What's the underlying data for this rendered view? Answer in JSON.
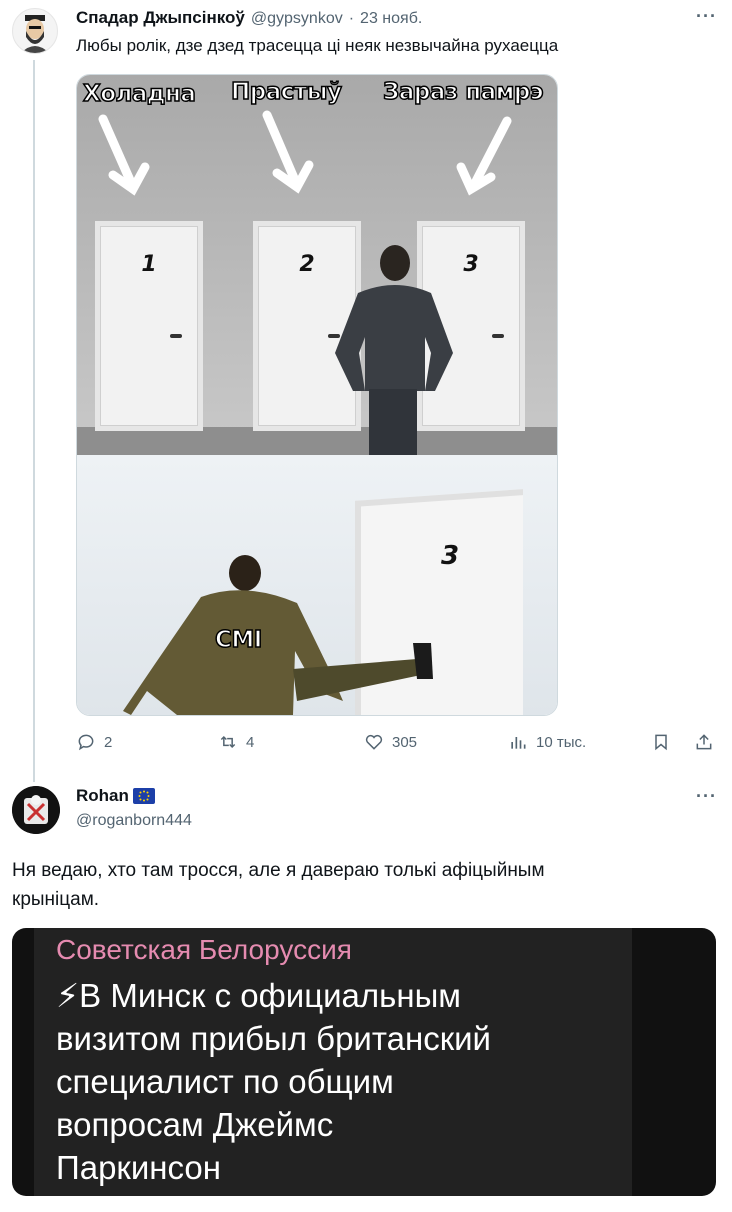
{
  "tweet1": {
    "author_name": "Спадар Джыпсінкоў",
    "handle": "@gypsynkov",
    "separator": "·",
    "date": "23 нояб.",
    "text": "Любы ролік, дзе дзед трасецца ці неяк незвычайна рухаецца",
    "meme": {
      "labels": [
        "Холадна",
        "Прастыў",
        "Зараз памрэ"
      ],
      "doors": [
        "1",
        "2",
        "3"
      ],
      "bottom_door": "3",
      "bottom_label": "СМІ"
    },
    "actions": {
      "replies": "2",
      "retweets": "4",
      "likes": "305",
      "views": "10 тыс."
    }
  },
  "tweet2": {
    "author_name": "Rohan",
    "badge": "eu-flag",
    "handle": "@roganborn444",
    "text_line1": "Ня ведаю, хто там тросся, але я давераю толькі афіцыйным",
    "text_line2": "крыніцам.",
    "card": {
      "channel": "Советская Белоруссия",
      "lines": [
        "⚡В Минск с официальным",
        "визитом прибыл британский",
        "специалист по общим",
        "вопросам Джеймс",
        "Паркинсон"
      ]
    }
  },
  "colors": {
    "text": "#0f1419",
    "muted": "#536471",
    "thread_line": "#cfd9de",
    "channel_pink": "#e58bb0"
  }
}
